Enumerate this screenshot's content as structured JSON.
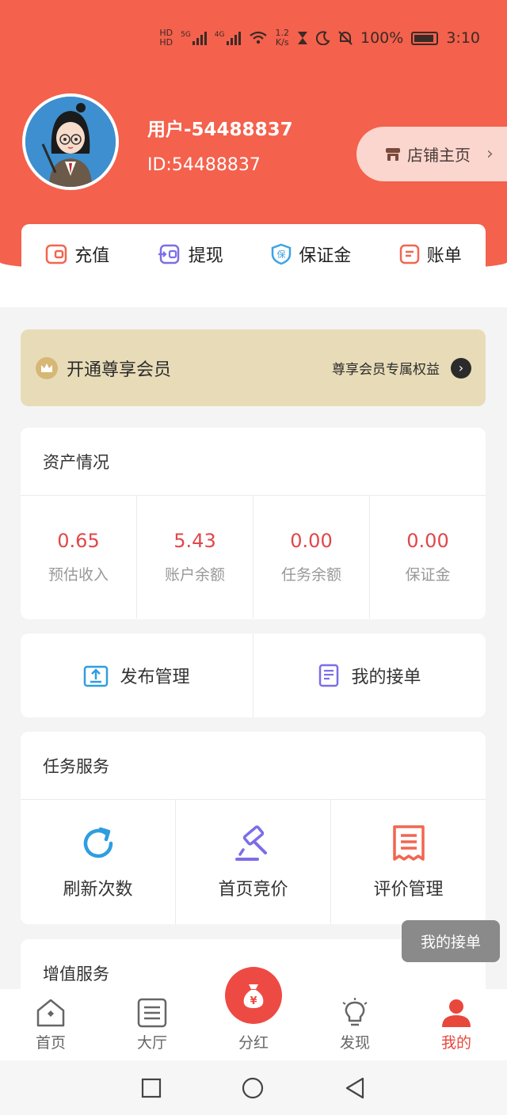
{
  "status_bar": {
    "hd1": "HD",
    "hd2": "HD",
    "net1": "5G",
    "net2": "4G",
    "speed_value": "1.2",
    "speed_unit": "K/s",
    "battery": "100%",
    "time": "3:10"
  },
  "profile": {
    "name": "用户-54488837",
    "id": "ID:54488837",
    "shop_button": "店铺主页"
  },
  "quick_actions": [
    {
      "label": "充值",
      "icon": "recharge-icon",
      "color": "#f2664f"
    },
    {
      "label": "提现",
      "icon": "withdraw-icon",
      "color": "#7b6ee8"
    },
    {
      "label": "保证金",
      "icon": "deposit-shield-icon",
      "color": "#3da3e4"
    },
    {
      "label": "账单",
      "icon": "bill-icon",
      "color": "#f2664f"
    }
  ],
  "vip_banner": {
    "title": "开通尊享会员",
    "benefits": "尊享会员专属权益"
  },
  "assets": {
    "title": "资产情况",
    "items": [
      {
        "value": "0.65",
        "label": "预估收入"
      },
      {
        "value": "5.43",
        "label": "账户余额"
      },
      {
        "value": "0.00",
        "label": "任务余额"
      },
      {
        "value": "0.00",
        "label": "保证金"
      }
    ]
  },
  "manage": {
    "publish": "发布管理",
    "my_orders": "我的接单"
  },
  "task_service": {
    "title": "任务服务",
    "items": [
      {
        "label": "刷新次数",
        "icon": "refresh-icon"
      },
      {
        "label": "首页竞价",
        "icon": "auction-hammer-icon"
      },
      {
        "label": "评价管理",
        "icon": "review-receipt-icon"
      }
    ]
  },
  "value_service": {
    "title": "增值服务"
  },
  "toast": "我的接单",
  "tabbar": [
    {
      "label": "首页",
      "icon": "home-icon"
    },
    {
      "label": "大厅",
      "icon": "hall-list-icon"
    },
    {
      "label": "分红",
      "icon": "money-bag-icon"
    },
    {
      "label": "发现",
      "icon": "lightbulb-icon"
    },
    {
      "label": "我的",
      "icon": "user-icon",
      "active": true
    }
  ],
  "colors": {
    "brand_red": "#f4614c",
    "asset_value_red": "#e0474a",
    "vip_gold": "#e8dcb8",
    "tab_active": "#e8473c"
  }
}
